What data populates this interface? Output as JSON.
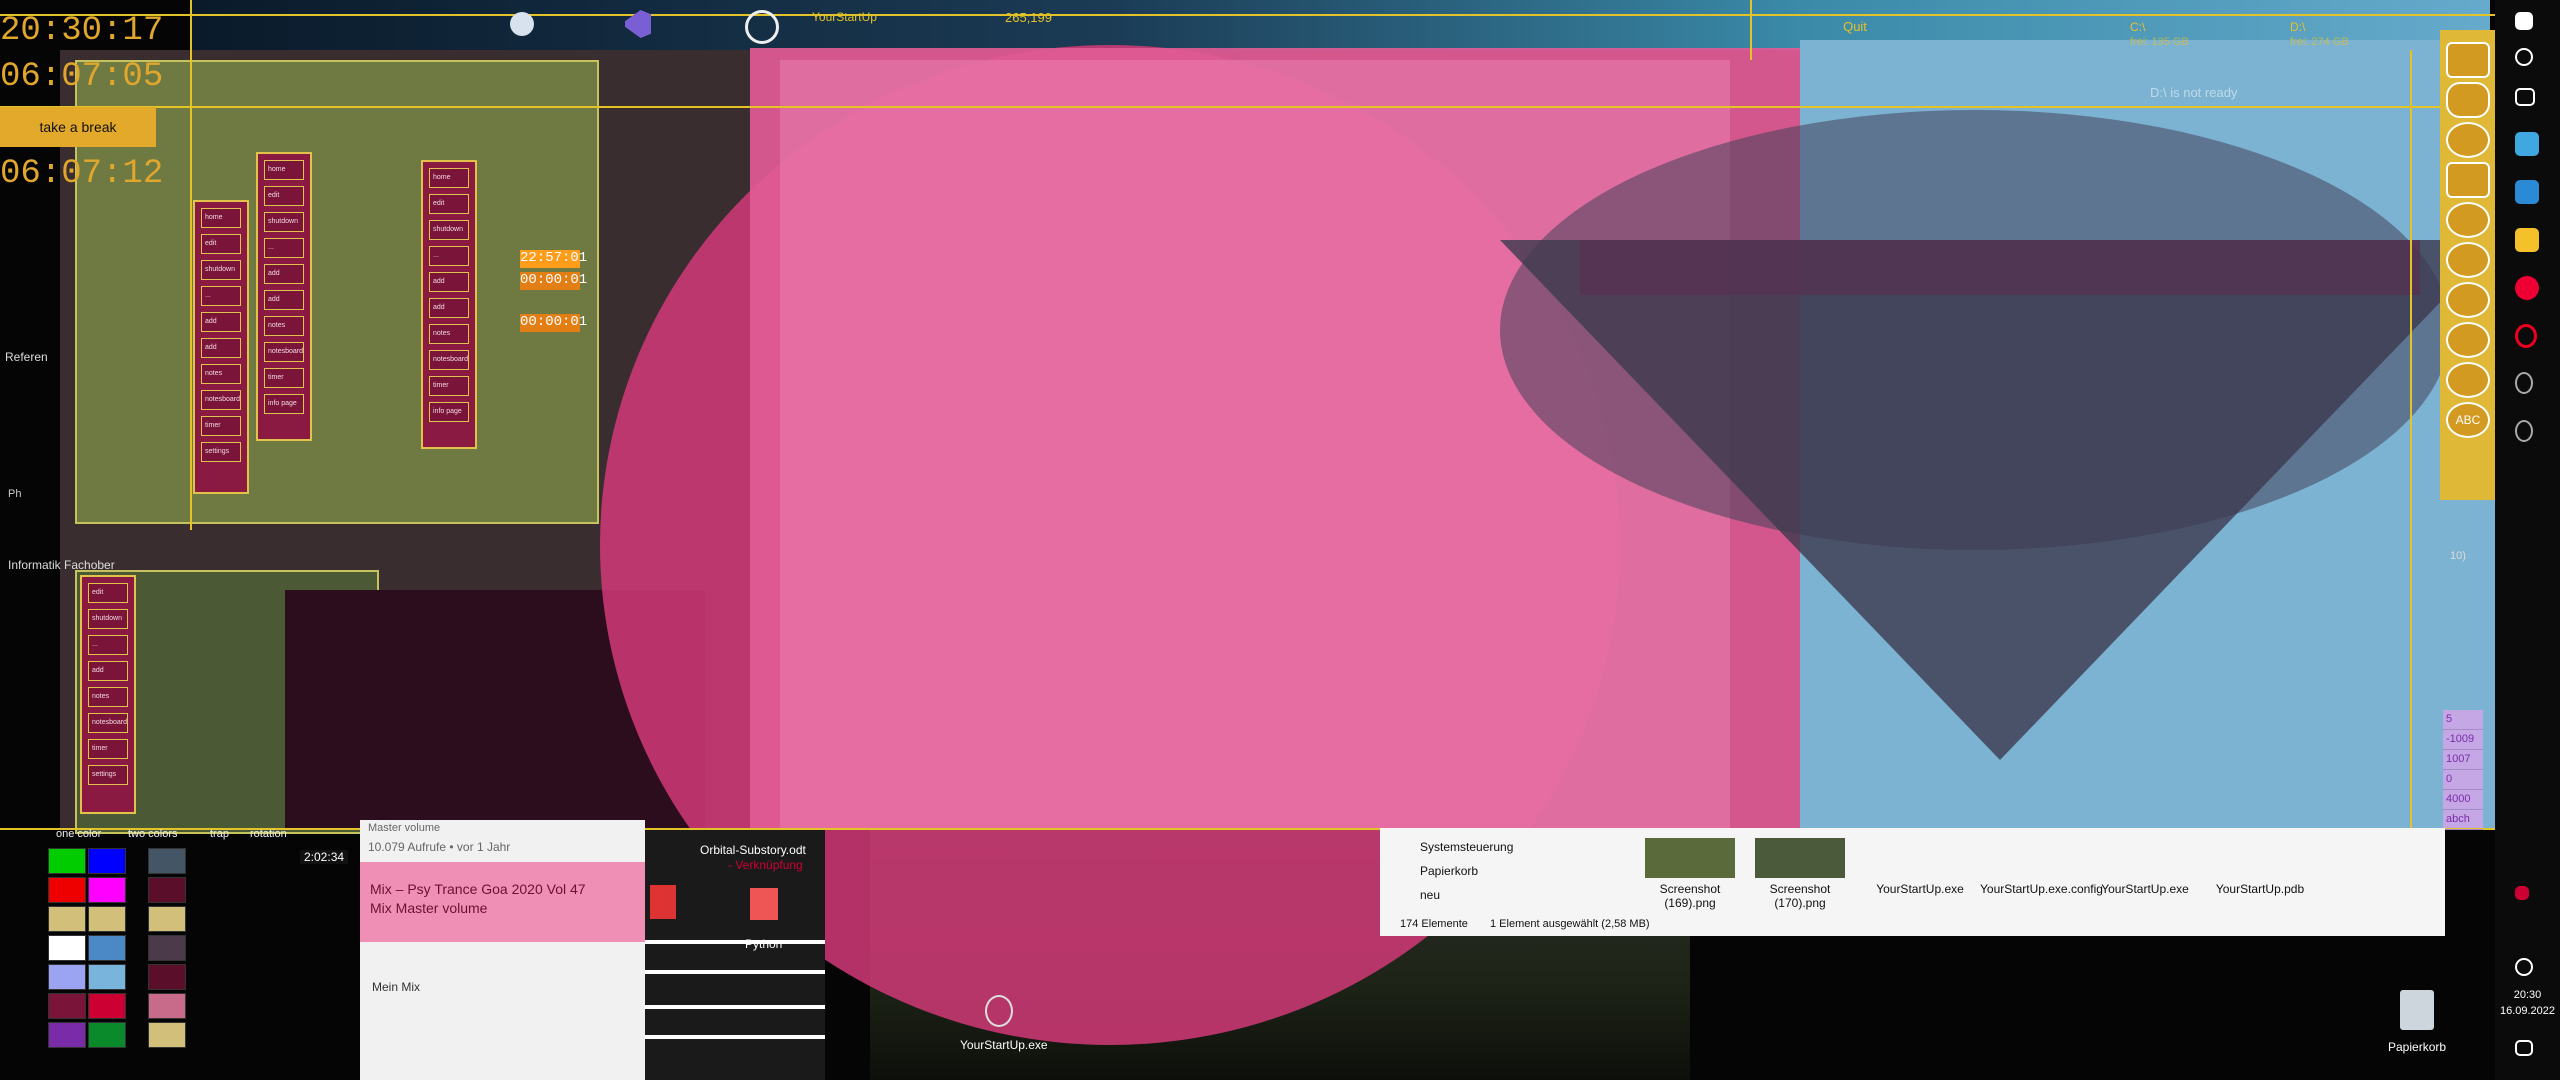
{
  "clock": {
    "time_main": "20:30:17",
    "elapsed_1": "06:07:05",
    "break_label": "take a break",
    "elapsed_2": "06:07:12"
  },
  "top_bar": {
    "app_label": "YourStartUp",
    "coords": "265;199",
    "quit_label": "Quit",
    "drive_c": "C:\\",
    "drive_c_free": "frei: 135 GB",
    "drive_d": "D:\\",
    "drive_d_free": "frei: 274 GB",
    "not_ready": "D:\\ is not ready"
  },
  "left_side": {
    "reference": "Referen",
    "information": "Informatik Fachober",
    "ph": "Ph"
  },
  "menu_items": [
    "home",
    "edit",
    "shutdown",
    "...",
    "add",
    "add",
    "notes",
    "notesboard",
    "timer",
    "settings",
    "info page"
  ],
  "timers": {
    "t1": "22:57:01",
    "t2": "00:00:01",
    "t3": "00:00:01"
  },
  "color_options": {
    "one_color": "one color",
    "two_colors": "two colors",
    "trapeze": "trap",
    "rotation": "rotation"
  },
  "video": {
    "duration": "2:02:34",
    "views": "10.079 Aufrufe • vor 1 Jahr",
    "title": "Mix – Psy Trance Goa 2020 Vol 47 Mix Master volume",
    "my_mix": "Mein Mix",
    "master_volume": "Master volume"
  },
  "desktop": {
    "orbital_file": "Orbital-Substory.odt",
    "link": "- Verknüpfung",
    "python": "Python",
    "youstartup_exe": "YourStartUp.exe",
    "recycle_bin": "Papierkorb"
  },
  "explorer": {
    "nav_items": [
      "Systemsteuerung",
      "Papierkorb",
      "neu"
    ],
    "files": [
      {
        "name": "Screenshot (169).png"
      },
      {
        "name": "Screenshot (170).png"
      },
      {
        "name": "YourStartUp.exe"
      },
      {
        "name": "YourStartUp.exe.config"
      },
      {
        "name": "YourStartUp.exe"
      },
      {
        "name": "YourStartUp.pdb"
      }
    ],
    "count": "174 Elemente",
    "selected": "1 Element ausgewählt (2,58 MB)"
  },
  "purple_values": [
    "5",
    "-1009",
    "1007",
    "0",
    "4000",
    "abch"
  ],
  "right_panel_abc": "ABC",
  "side_number": "10)",
  "taskbar": {
    "time": "20:30",
    "date": "16.09.2022"
  }
}
